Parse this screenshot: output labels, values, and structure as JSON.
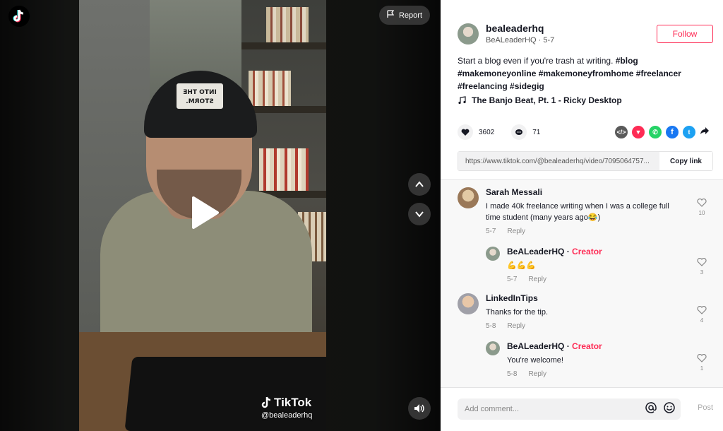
{
  "video": {
    "report_label": "Report",
    "watermark_brand": "TikTok",
    "watermark_user": "@bealeaderhq",
    "cap_text": "INTO THE STORM"
  },
  "author": {
    "username": "bealeaderhq",
    "display_name": "BeALeaderHQ",
    "date": "5-7",
    "follow_label": "Follow"
  },
  "caption": {
    "text": "Start a blog even if you're trash at writing.",
    "tags": [
      "#blog",
      "#makemoneyonline",
      "#makemoneyfromhome",
      "#freelancer",
      "#freelancing",
      "#sidegig"
    ]
  },
  "music": "The Banjo Beat, Pt. 1 - Ricky Desktop",
  "stats": {
    "likes": "3602",
    "comments": "71"
  },
  "share_icons": [
    {
      "name": "embed-icon",
      "color": "#5a5a5a",
      "glyph": "</>"
    },
    {
      "name": "paper-plane-icon",
      "color": "#fe2c55",
      "glyph": "▼"
    },
    {
      "name": "whatsapp-icon",
      "color": "#25d366",
      "glyph": "✆"
    },
    {
      "name": "facebook-icon",
      "color": "#1877f2",
      "glyph": "f"
    },
    {
      "name": "twitter-icon",
      "color": "#1da1f2",
      "glyph": "t"
    }
  ],
  "link": {
    "url": "https://www.tiktok.com/@bealeaderhq/video/7095064757...",
    "copy_label": "Copy link"
  },
  "comments": [
    {
      "name": "Sarah Messali",
      "text": "I made 40k freelance writing when I was a college full time student (many years ago😂)",
      "date": "5-7",
      "reply": "Reply",
      "likes": "10"
    },
    {
      "name": "BeALeaderHQ",
      "badge": "Creator",
      "sep": "·",
      "text": "💪💪💪",
      "date": "5-7",
      "reply": "Reply",
      "likes": "3"
    },
    {
      "name": "LinkedInTips",
      "text": "Thanks for the tip.",
      "date": "5-8",
      "reply": "Reply",
      "likes": "4"
    },
    {
      "name": "BeALeaderHQ",
      "badge": "Creator",
      "sep": "·",
      "text": "You're welcome!",
      "date": "5-8",
      "reply": "Reply",
      "likes": "1"
    }
  ],
  "compose": {
    "placeholder": "Add comment...",
    "post_label": "Post"
  }
}
